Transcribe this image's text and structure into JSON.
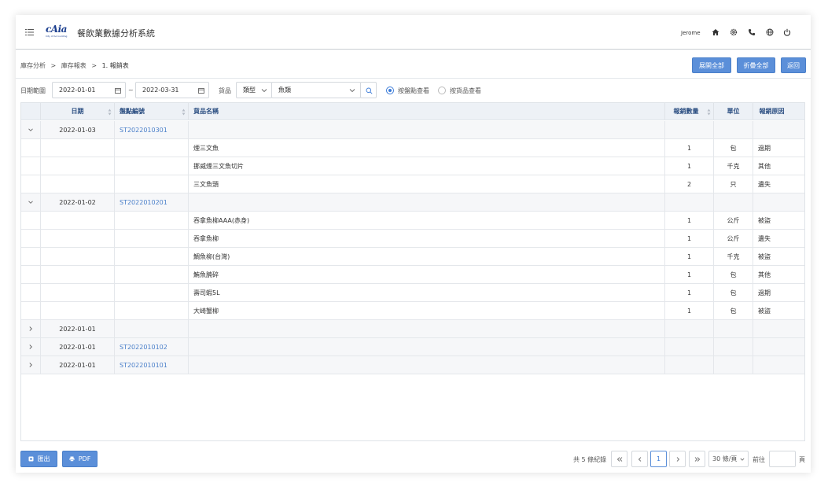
{
  "header": {
    "logo_text": "cAia",
    "logo_sub": "City of Accounting",
    "system_title": "餐飲業數據分析系統",
    "user_name": "Jerome"
  },
  "breadcrumb": {
    "items": [
      "庫存分析",
      "庫存報表",
      "1. 報銷表"
    ],
    "separator": ">"
  },
  "actions": {
    "expand_all": "展開全部",
    "collapse_all": "折疊全部",
    "back": "返回"
  },
  "filters": {
    "date_range_label": "日期範圍",
    "start_date": "2022-01-01",
    "date_separator": "~",
    "end_date": "2022-03-31",
    "goods_label": "貨品",
    "type_value": "類型",
    "category_value": "魚類",
    "radio_by_count": "按盤點查看",
    "radio_by_goods": "按貨品查看",
    "selected_view": "按盤點查看"
  },
  "table": {
    "columns": {
      "date": "日期",
      "count_no": "盤點編號",
      "goods_name": "貨品名稱",
      "qty": "報銷數量",
      "unit": "單位",
      "reason": "報銷原因"
    },
    "groups": [
      {
        "date": "2022-01-03",
        "count_no": "ST2022010301",
        "expanded": true,
        "items": [
          {
            "name": "煙三文魚",
            "qty": "1",
            "unit": "包",
            "reason": "過期"
          },
          {
            "name": "挪威煙三文魚切片",
            "qty": "1",
            "unit": "千克",
            "reason": "其他"
          },
          {
            "name": "三文魚頭",
            "qty": "2",
            "unit": "只",
            "reason": "遺失"
          }
        ]
      },
      {
        "date": "2022-01-02",
        "count_no": "ST2022010201",
        "expanded": true,
        "items": [
          {
            "name": "吞拿魚柳AAA(赤身)",
            "qty": "1",
            "unit": "公斤",
            "reason": "被盜"
          },
          {
            "name": "吞拿魚柳",
            "qty": "1",
            "unit": "公斤",
            "reason": "遺失"
          },
          {
            "name": "鯛魚柳(台灣)",
            "qty": "1",
            "unit": "千克",
            "reason": "被盜"
          },
          {
            "name": "鮪魚腩碎",
            "qty": "1",
            "unit": "包",
            "reason": "其他"
          },
          {
            "name": "壽司蝦5L",
            "qty": "1",
            "unit": "包",
            "reason": "過期"
          },
          {
            "name": "大崎蟹柳",
            "qty": "1",
            "unit": "包",
            "reason": "被盜"
          }
        ]
      },
      {
        "date": "2022-01-01",
        "count_no": "",
        "expanded": false,
        "items": []
      },
      {
        "date": "2022-01-01",
        "count_no": "ST2022010102",
        "expanded": false,
        "items": []
      },
      {
        "date": "2022-01-01",
        "count_no": "ST2022010101",
        "expanded": false,
        "items": []
      }
    ]
  },
  "footer": {
    "export_label": "匯出",
    "pdf_label": "PDF",
    "total_text": "共 5 條紀錄",
    "current_page": "1",
    "page_size": "30 條/頁",
    "goto_label": "前往",
    "page_suffix": "頁",
    "goto_value": ""
  },
  "colors": {
    "accent": "#5b8fd9",
    "link": "#4a7fc9",
    "header_bg": "#edf1f6"
  }
}
